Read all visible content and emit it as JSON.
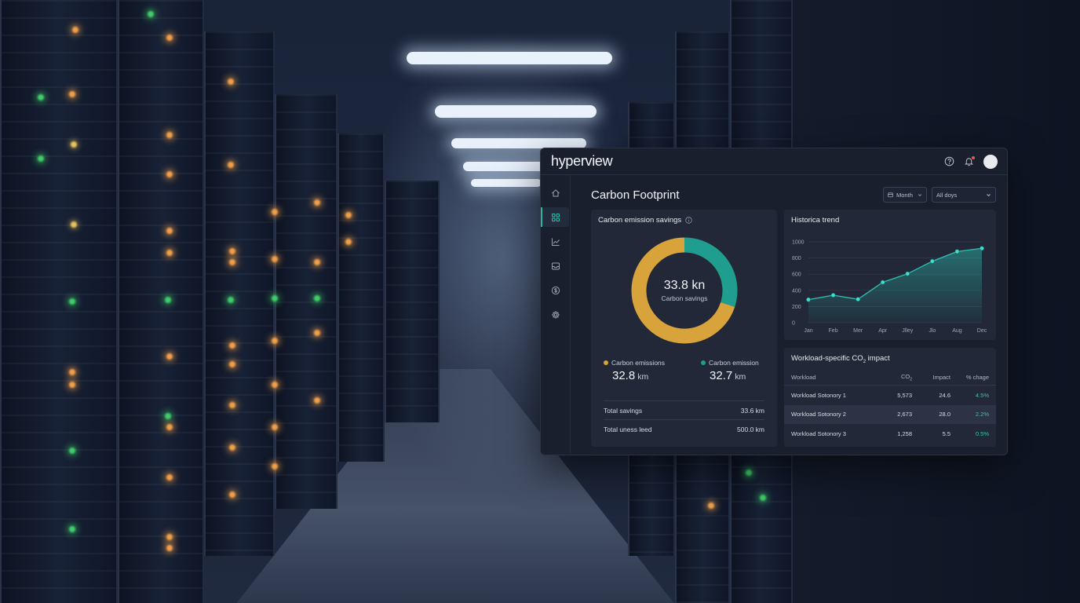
{
  "app": {
    "logo": "hyperview"
  },
  "colors": {
    "accent_teal": "#1f9e8f",
    "accent_gold": "#d9a33b",
    "positive": "#34c7b0",
    "panel": "#222838"
  },
  "topbar": {
    "icons": [
      "help-icon",
      "bell-icon",
      "avatar"
    ],
    "has_notification": true
  },
  "sidebar": {
    "items": [
      {
        "icon": "home-icon",
        "active": false
      },
      {
        "icon": "grid-icon",
        "active": true
      },
      {
        "icon": "chart-line-icon",
        "active": false
      },
      {
        "icon": "inbox-icon",
        "active": false
      },
      {
        "icon": "coin-icon",
        "active": false
      },
      {
        "icon": "gear-icon",
        "active": false
      }
    ]
  },
  "page": {
    "title": "Carbon Footprint",
    "filter_period": "Month",
    "filter_range": "All doys"
  },
  "savings": {
    "title": "Carbon emission savings",
    "center_value": "33.8 kn",
    "center_label": "Carbon savings",
    "legend": [
      {
        "label": "Carbon emissions",
        "value": "32.8",
        "unit": "km",
        "color": "#d9a33b"
      },
      {
        "label": "Carbon emission",
        "value": "32.7",
        "unit": "km",
        "color": "#1f9e8f"
      }
    ],
    "rows": [
      {
        "label": "Total savings",
        "value": "33.6 km"
      },
      {
        "label": "Total uness leed",
        "value": "500.0 km"
      }
    ]
  },
  "chart_data": {
    "type": "donut_and_area",
    "donut": {
      "type": "pie",
      "slices": [
        {
          "name": "Carbon emissions",
          "fraction": 0.7,
          "color": "#d9a33b"
        },
        {
          "name": "Carbon emission",
          "fraction": 0.3,
          "color": "#1f9e8f"
        }
      ]
    },
    "trend": {
      "type": "area",
      "title": "Historica trend",
      "x_ticks": [
        "Jan",
        "Feb",
        "Mer",
        "Apr",
        "Jlley",
        "Jlo",
        "Aug",
        "Dec"
      ],
      "y_ticks": [
        0,
        200,
        400,
        600,
        800,
        1000
      ],
      "ylim": [
        0,
        1000
      ],
      "values": [
        285,
        340,
        290,
        500,
        605,
        760,
        880,
        920
      ],
      "grid": true,
      "color": "#2cc3b2"
    }
  },
  "workload": {
    "title_main": "Workload-specific CO",
    "title_sub": "2",
    "title_tail": " impact",
    "columns": {
      "name": "Workload",
      "co2": "CO",
      "co2_sub": "2",
      "impact": "Impact",
      "change": "% chage"
    },
    "rows": [
      {
        "name": "Workload Sotonory 1",
        "co2": "5,573",
        "impact": "24.6",
        "change": "4.5%"
      },
      {
        "name": "Workload Sotonory 2",
        "co2": "2,673",
        "impact": "28.0",
        "change": "2.2%"
      },
      {
        "name": "Workload Sotonory 3",
        "co2": "1,258",
        "impact": "5.5",
        "change": "0.5%"
      }
    ]
  }
}
